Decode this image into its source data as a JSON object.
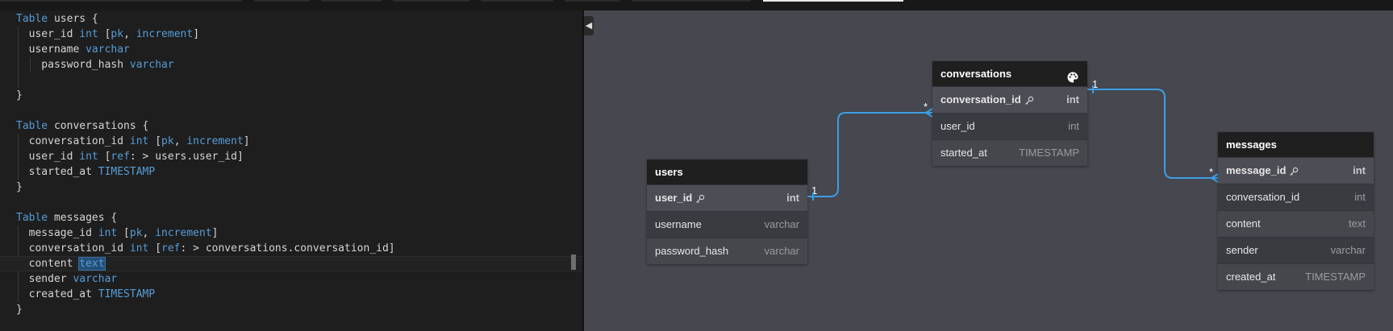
{
  "editor": {
    "lines": [
      [
        {
          "t": "Table",
          "c": "kw"
        },
        {
          "t": " users {"
        }
      ],
      [
        {
          "t": "  user_id "
        },
        {
          "t": "int",
          "c": "kw"
        },
        {
          "t": " ["
        },
        {
          "t": "pk",
          "c": "kw"
        },
        {
          "t": ", "
        },
        {
          "t": "increment",
          "c": "kw"
        },
        {
          "t": "]"
        }
      ],
      [
        {
          "t": "  username "
        },
        {
          "t": "varchar",
          "c": "kw"
        }
      ],
      [
        {
          "t": "    password_hash "
        },
        {
          "t": "varchar",
          "c": "kw"
        }
      ],
      [
        {
          "t": ""
        }
      ],
      [
        {
          "t": "}"
        }
      ],
      [
        {
          "t": ""
        }
      ],
      [
        {
          "t": "Table",
          "c": "kw"
        },
        {
          "t": " conversations {"
        }
      ],
      [
        {
          "t": "  conversation_id "
        },
        {
          "t": "int",
          "c": "kw"
        },
        {
          "t": " ["
        },
        {
          "t": "pk",
          "c": "kw"
        },
        {
          "t": ", "
        },
        {
          "t": "increment",
          "c": "kw"
        },
        {
          "t": "]"
        }
      ],
      [
        {
          "t": "  user_id "
        },
        {
          "t": "int",
          "c": "kw"
        },
        {
          "t": " ["
        },
        {
          "t": "ref",
          "c": "kw"
        },
        {
          "t": ": > users.user_id]"
        }
      ],
      [
        {
          "t": "  started_at "
        },
        {
          "t": "TIMESTAMP",
          "c": "kw"
        }
      ],
      [
        {
          "t": "}"
        }
      ],
      [
        {
          "t": ""
        }
      ],
      [
        {
          "t": "Table",
          "c": "kw"
        },
        {
          "t": " messages {"
        }
      ],
      [
        {
          "t": "  message_id "
        },
        {
          "t": "int",
          "c": "kw"
        },
        {
          "t": " ["
        },
        {
          "t": "pk",
          "c": "kw"
        },
        {
          "t": ", "
        },
        {
          "t": "increment",
          "c": "kw"
        },
        {
          "t": "]"
        }
      ],
      [
        {
          "t": "  conversation_id "
        },
        {
          "t": "int",
          "c": "kw"
        },
        {
          "t": " ["
        },
        {
          "t": "ref",
          "c": "kw"
        },
        {
          "t": ": > conversations.conversation_id]"
        }
      ],
      [
        {
          "t": "  content "
        },
        {
          "t": "text",
          "c": "kw sel-word"
        }
      ],
      [
        {
          "t": "  sender "
        },
        {
          "t": "varchar",
          "c": "kw"
        }
      ],
      [
        {
          "t": "  created_at "
        },
        {
          "t": "TIMESTAMP",
          "c": "kw"
        }
      ],
      [
        {
          "t": "}"
        }
      ]
    ],
    "current_line": 16
  },
  "diagram": {
    "tables": [
      {
        "id": "users",
        "name": "users",
        "fields": [
          {
            "name": "user_id",
            "type": "int",
            "pk": true
          },
          {
            "name": "username",
            "type": "varchar",
            "pk": false
          },
          {
            "name": "password_hash",
            "type": "varchar",
            "pk": false
          }
        ]
      },
      {
        "id": "conversations",
        "name": "conversations",
        "has_palette": true,
        "fields": [
          {
            "name": "conversation_id",
            "type": "int",
            "pk": true
          },
          {
            "name": "user_id",
            "type": "int",
            "pk": false
          },
          {
            "name": "started_at",
            "type": "TIMESTAMP",
            "pk": false
          }
        ]
      },
      {
        "id": "messages",
        "name": "messages",
        "fields": [
          {
            "name": "message_id",
            "type": "int",
            "pk": true
          },
          {
            "name": "conversation_id",
            "type": "int",
            "pk": false
          },
          {
            "name": "content",
            "type": "text",
            "pk": false
          },
          {
            "name": "sender",
            "type": "varchar",
            "pk": false
          },
          {
            "name": "created_at",
            "type": "TIMESTAMP",
            "pk": false
          }
        ]
      }
    ],
    "relations": [
      {
        "from": "users.user_id",
        "to": "conversations.user_id",
        "from_card": "1",
        "to_card": "*"
      },
      {
        "from": "conversations.conversation_id",
        "to": "messages.conversation_id",
        "from_card": "1",
        "to_card": "*"
      }
    ],
    "line_color": "#3d9ee5"
  },
  "collapse_icon": "chevron-left-icon"
}
